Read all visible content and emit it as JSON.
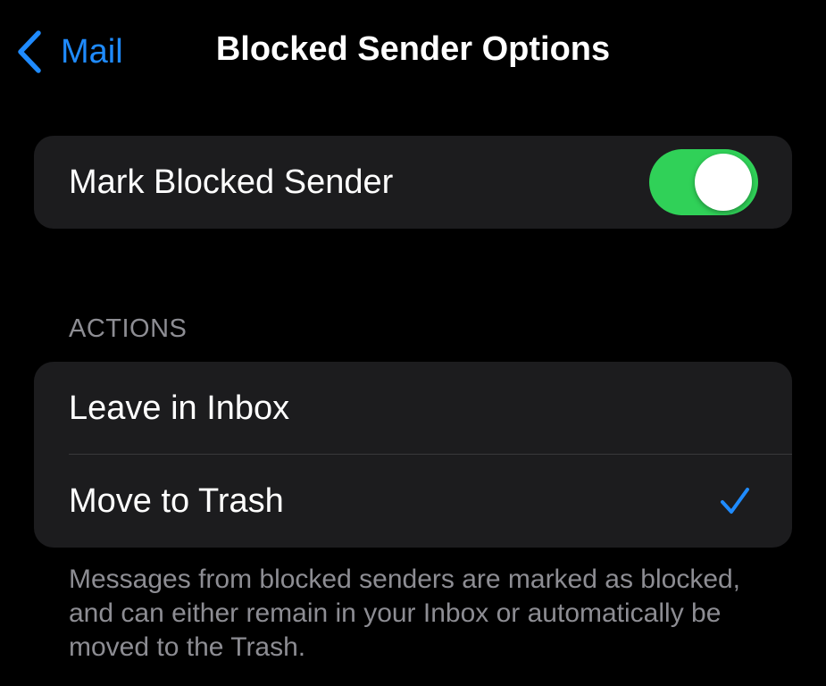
{
  "nav": {
    "back_label": "Mail",
    "back_icon": "chevron-left-icon",
    "title": "Blocked Sender Options"
  },
  "mark_blocked": {
    "label": "Mark Blocked Sender",
    "enabled": true
  },
  "actions": {
    "header": "ACTIONS",
    "options": [
      {
        "label": "Leave in Inbox",
        "selected": false
      },
      {
        "label": "Move to Trash",
        "selected": true
      }
    ],
    "selected_icon": "checkmark-icon"
  },
  "footer": "Messages from blocked senders are marked as blocked, and can either remain in your Inbox or automatically be moved to the Trash.",
  "colors": {
    "accent": "#1f8bff",
    "toggle_on": "#30d158",
    "group_background": "#1c1c1e",
    "secondary_text": "#8d8d93"
  }
}
